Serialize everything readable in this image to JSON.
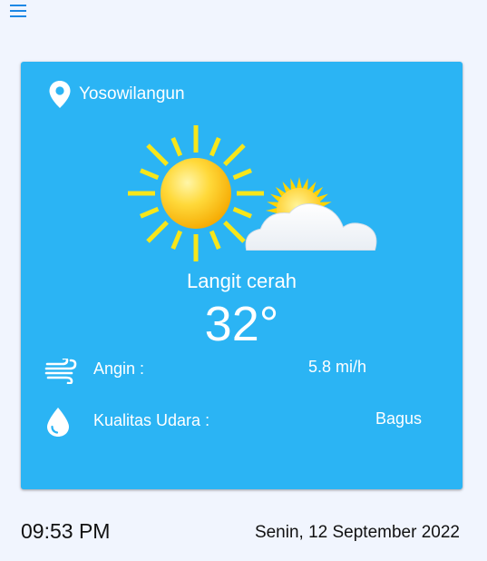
{
  "header": {
    "menu_icon": "hamburger-menu-icon"
  },
  "weather": {
    "location": "Yosowilangun",
    "location_icon": "location-pin-icon",
    "illustration": "sun-and-cloud-icon",
    "condition": "Langit cerah",
    "temperature": "32°",
    "wind": {
      "icon": "wind-icon",
      "label": "Angin :",
      "value": "5.8 mi/h"
    },
    "air_quality": {
      "icon": "water-drop-icon",
      "label": "Kualitas Udara :",
      "value": "Bagus"
    }
  },
  "footer": {
    "time": "09:53 PM",
    "date": "Senin, 12 September 2022"
  },
  "colors": {
    "page_bg": "#f1f5fe",
    "card_bg": "#2bb4f4",
    "menu_icon": "#1e88e5",
    "text_light": "#ffffff",
    "text_dark": "#111111",
    "sun_ray": "#f7e61a",
    "sun_core": "#ffc820"
  }
}
